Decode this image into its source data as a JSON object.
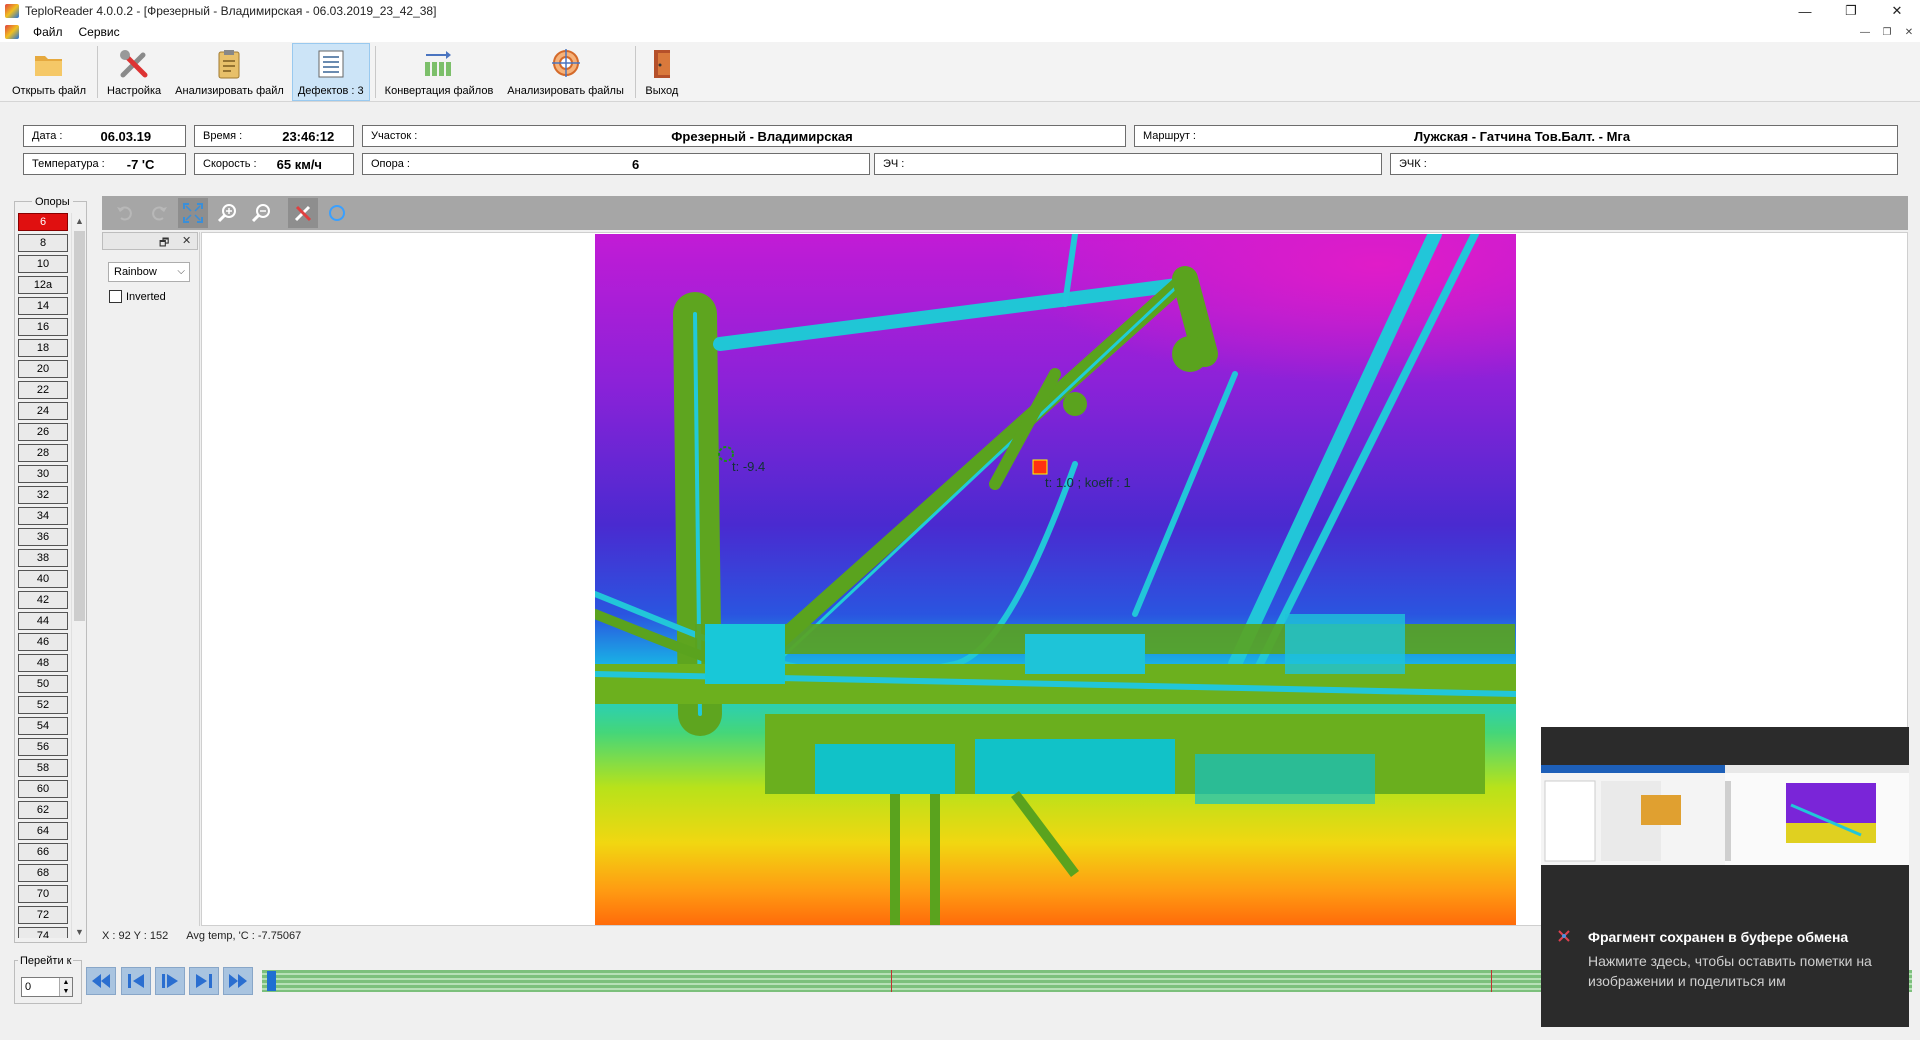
{
  "window": {
    "title": "TeploReader 4.0.0.2 - [Фрезерный - Владимирская - 06.03.2019_23_42_38]",
    "minimize": "—",
    "restore": "❐",
    "close": "✕"
  },
  "menu": {
    "items": [
      "Файл",
      "Сервис"
    ],
    "mdi": [
      "—",
      "❐",
      "✕"
    ]
  },
  "toolbar": {
    "buttons": [
      {
        "label": "Открыть файл",
        "icon": "folder-icon"
      },
      {
        "label": "Настройка",
        "icon": "tools-icon"
      },
      {
        "label": "Анализировать файл",
        "icon": "clipboard-icon"
      },
      {
        "label": "Дефектов : 3",
        "icon": "list-icon",
        "active": true
      },
      {
        "label": "Конвертация файлов",
        "icon": "convert-icon"
      },
      {
        "label": "Анализировать файлы",
        "icon": "target-icon"
      },
      {
        "label": "Выход",
        "icon": "exit-door-icon"
      }
    ]
  },
  "info": {
    "date_label": "Дата :",
    "date_value": "06.03.19",
    "time_label": "Время :",
    "time_value": "23:46:12",
    "section_label": "Участок :",
    "section_value": "Фрезерный - Владимирская",
    "route_label": "Маршрут :",
    "route_value": "Лужская - Гатчина Тов.Балт. - Мга",
    "temp_label": "Температура :",
    "temp_value": "-7 'C",
    "speed_label": "Скорость :",
    "speed_value": "65 км/ч",
    "support_label": "Опора :",
    "support_value": "6",
    "ech_label": "ЭЧ :",
    "ech_value": "",
    "echk_label": "ЭЧК :",
    "echk_value": ""
  },
  "supports": {
    "title": "Опоры",
    "items": [
      "6",
      "8",
      "10",
      "12а",
      "14",
      "16",
      "18",
      "20",
      "22",
      "24",
      "26",
      "28",
      "30",
      "32",
      "34",
      "36",
      "38",
      "40",
      "42",
      "44",
      "46",
      "48",
      "50",
      "52",
      "54",
      "56",
      "58",
      "60",
      "62",
      "64",
      "66",
      "68",
      "70",
      "72",
      "74"
    ],
    "selected": "6"
  },
  "image_tools": [
    "undo-icon",
    "redo-icon",
    "fit-icon",
    "zoom-in-icon",
    "zoom-out-icon",
    "settings-tools-icon",
    "circle-select-icon"
  ],
  "palette": {
    "selected": "Rainbow",
    "inverted_label": "Inverted",
    "inverted_checked": false
  },
  "thermal": {
    "marker1": "t: -9.4",
    "marker2": "t: 1.0 ; koeff : 1"
  },
  "status": {
    "coords": "X : 92 Y : 152",
    "avg": "Avg temp, 'C : -7.75067"
  },
  "navigation": {
    "goto_label": "Перейти к",
    "goto_value": "0",
    "timeline_end": "2",
    "timeline_position": 0.003
  },
  "toast": {
    "title": "Фрагмент сохранен в буфере обмена",
    "body": "Нажмите здесь, чтобы оставить пометки на изображении и поделиться им"
  }
}
